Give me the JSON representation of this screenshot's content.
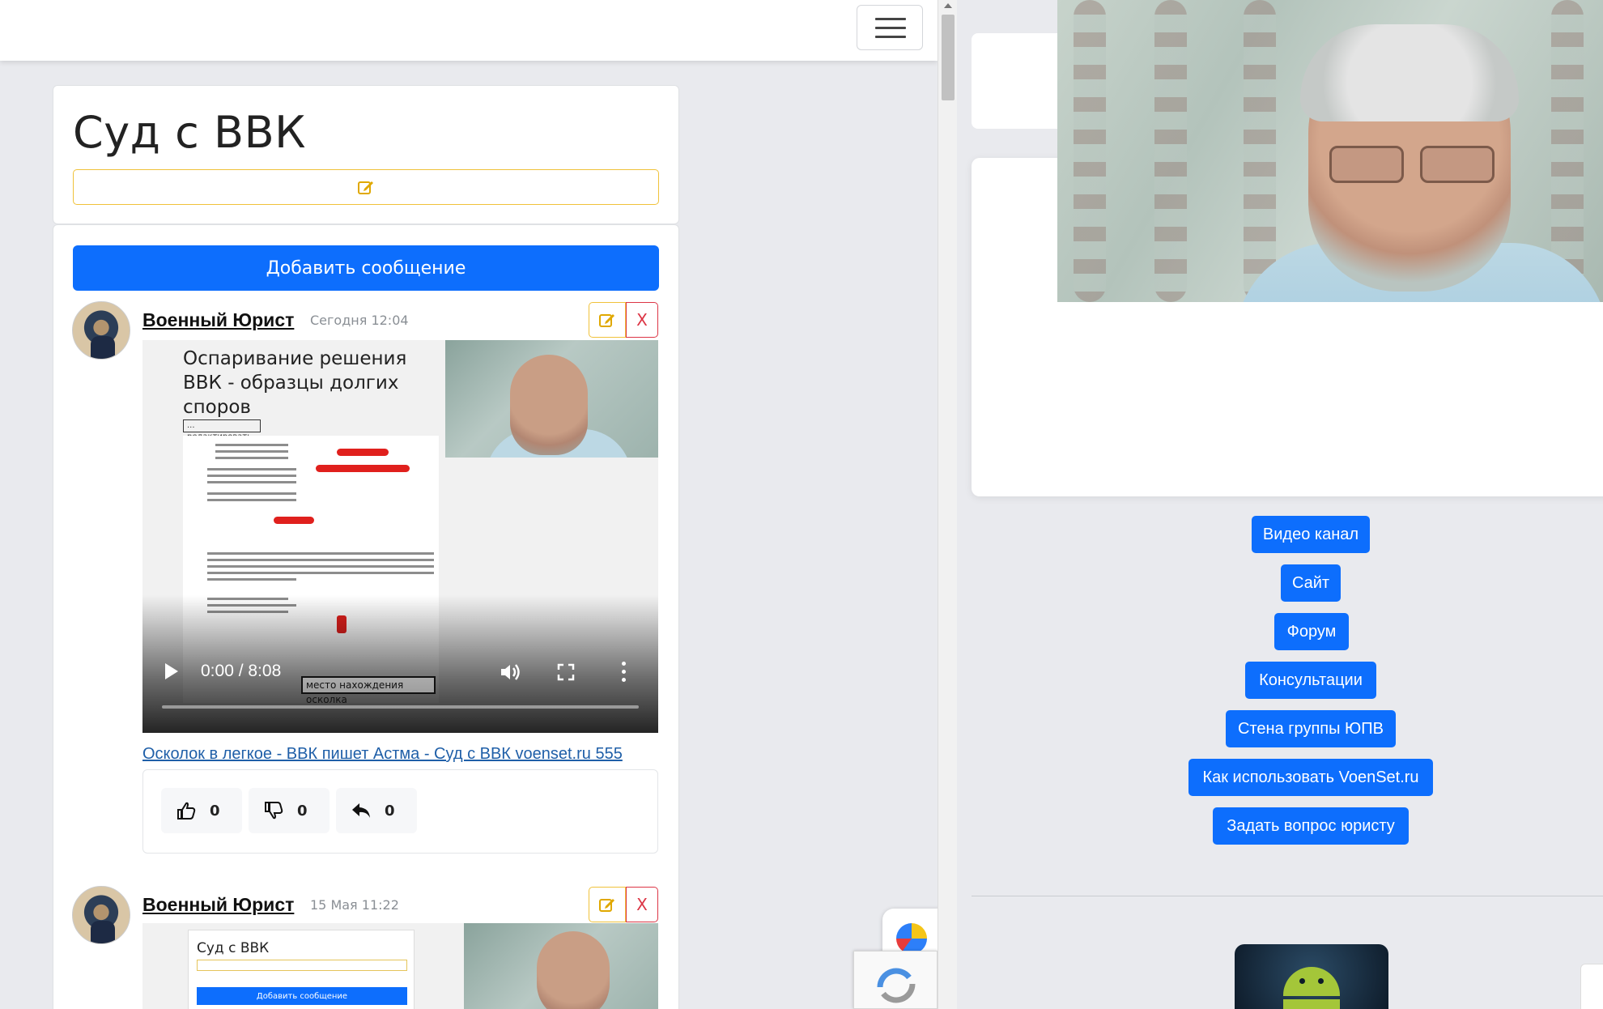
{
  "topbar": {
    "menu_icon": "hamburger-menu-icon"
  },
  "page": {
    "title": "Суд с ВВК",
    "edit_icon": "edit-icon",
    "add_message_label": "Добавить сообщение"
  },
  "posts": [
    {
      "author": "Военный Юрист",
      "time": "Сегодня 12:04",
      "delete_label": "X",
      "video": {
        "slide_title": "Оспаривание решения ВВК - образцы долгих споров",
        "edit_tag": "... редактировать ...",
        "time_label": "0:00 / 8:08",
        "caption_box": "место нахождения осколка"
      },
      "link_text": "Осколок в легкое - ВВК пишет Астма - Суд с ВВК voenset.ru 555",
      "reactions": {
        "likes": "0",
        "dislikes": "0",
        "replies": "0"
      }
    },
    {
      "author": "Военный Юрист",
      "time": "15 Мая 11:22",
      "delete_label": "X",
      "preview": {
        "title": "Суд с ВВК",
        "button_label": "Добавить сообщение"
      }
    }
  ],
  "sidebar": {
    "buttons": [
      "Видео канал",
      "Сайт",
      "Форум",
      "Консультации",
      "Стена группы ЮПВ",
      "Как использовать VoenSet.ru",
      "Задать вопрос юристу"
    ]
  },
  "colors": {
    "primary": "#0d6efd",
    "warning": "#f0c23a",
    "danger": "#dc3545",
    "background": "#e9eaee"
  }
}
